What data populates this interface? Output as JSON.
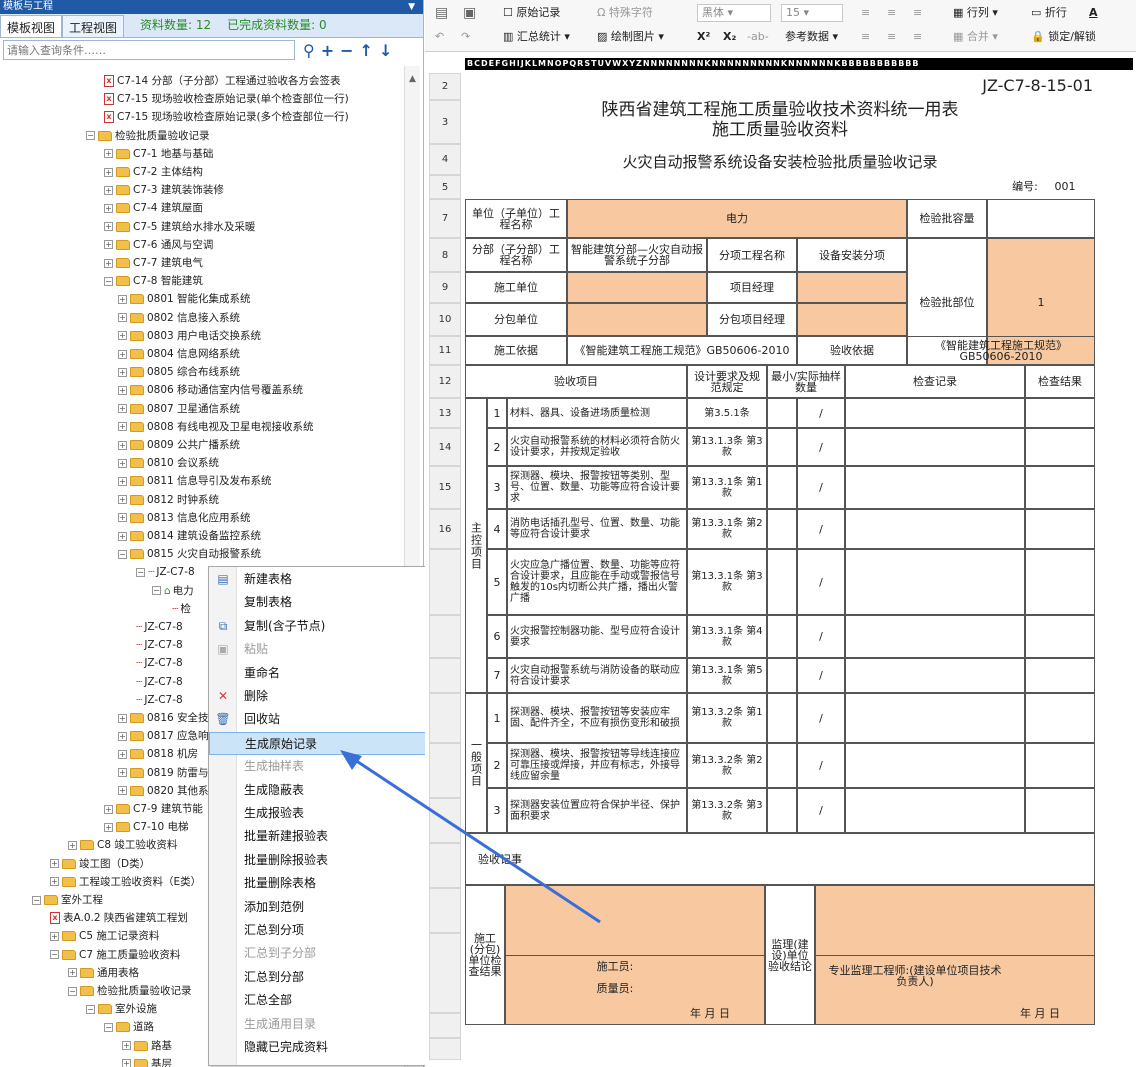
{
  "left_panel": {
    "title": "模板与工程",
    "pin": "▼",
    "tabs": [
      "模板视图",
      "工程视图"
    ],
    "count_label": "资料数量: 12",
    "done_label": "已完成资料数量: 0",
    "search_placeholder": "请输入查询条件……"
  },
  "tree": [
    {
      "text": "C7-14 分部（子分部）工程通过验收各方会签表",
      "icon": "pdf"
    },
    {
      "text": "C7-15 现场验收检查原始记录(单个检查部位一行)",
      "icon": "pdf"
    },
    {
      "text": "C7-15 现场验收检查原始记录(多个检查部位一行)",
      "icon": "pdf"
    },
    {
      "text": "检验批质量验收记录",
      "icon": "folder",
      "exp": "−"
    },
    {
      "text": "C7-1 地基与基础",
      "icon": "folder",
      "exp": "+"
    },
    {
      "text": "C7-2 主体结构",
      "icon": "folder",
      "exp": "+"
    },
    {
      "text": "C7-3 建筑装饰装修",
      "icon": "folder",
      "exp": "+"
    },
    {
      "text": "C7-4 建筑屋面",
      "icon": "folder",
      "exp": "+"
    },
    {
      "text": "C7-5 建筑给水排水及采暖",
      "icon": "folder",
      "exp": "+"
    },
    {
      "text": "C7-6 通风与空调",
      "icon": "folder",
      "exp": "+"
    },
    {
      "text": "C7-7 建筑电气",
      "icon": "folder",
      "exp": "+"
    },
    {
      "text": "C7-8 智能建筑",
      "icon": "folder",
      "exp": "−"
    },
    {
      "text": "0801 智能化集成系统",
      "icon": "folder",
      "exp": "+"
    },
    {
      "text": "0802 信息接入系统",
      "icon": "folder",
      "exp": "+"
    },
    {
      "text": "0803 用户电话交换系统",
      "icon": "folder",
      "exp": "+"
    },
    {
      "text": "0804 信息网络系统",
      "icon": "folder",
      "exp": "+"
    },
    {
      "text": "0805 综合布线系统",
      "icon": "folder",
      "exp": "+"
    },
    {
      "text": "0806 移动通信室内信号覆盖系统",
      "icon": "folder",
      "exp": "+"
    },
    {
      "text": "0807 卫星通信系统",
      "icon": "folder",
      "exp": "+"
    },
    {
      "text": "0808 有线电视及卫星电视接收系统",
      "icon": "folder",
      "exp": "+"
    },
    {
      "text": "0809 公共广播系统",
      "icon": "folder",
      "exp": "+"
    },
    {
      "text": "0810 会议系统",
      "icon": "folder",
      "exp": "+"
    },
    {
      "text": "0811 信息导引及发布系统",
      "icon": "folder",
      "exp": "+"
    },
    {
      "text": "0812 时钟系统",
      "icon": "folder",
      "exp": "+"
    },
    {
      "text": "0813 信息化应用系统",
      "icon": "folder",
      "exp": "+"
    },
    {
      "text": "0814 建筑设备监控系统",
      "icon": "folder",
      "exp": "+"
    },
    {
      "text": "0815 火灾自动报警系统",
      "icon": "folder",
      "exp": "−"
    },
    {
      "text": "JZ-C7-8",
      "icon": "jian",
      "exp": "−"
    },
    {
      "text": "电力",
      "icon": "home",
      "exp": "−"
    },
    {
      "text": "检",
      "icon": "jian"
    },
    {
      "text": "JZ-C7-8",
      "icon": "jian"
    },
    {
      "text": "JZ-C7-8",
      "icon": "jian"
    },
    {
      "text": "JZ-C7-8",
      "icon": "jian"
    },
    {
      "text": "JZ-C7-8",
      "icon": "jian"
    },
    {
      "text": "JZ-C7-8",
      "icon": "jian"
    },
    {
      "text": "0816 安全技",
      "icon": "folder",
      "exp": "+"
    },
    {
      "text": "0817 应急响",
      "icon": "folder",
      "exp": "+"
    },
    {
      "text": "0818 机房",
      "icon": "folder",
      "exp": "+"
    },
    {
      "text": "0819 防雷与",
      "icon": "folder",
      "exp": "+"
    },
    {
      "text": "0820 其他系",
      "icon": "folder",
      "exp": "+"
    },
    {
      "text": "C7-9 建筑节能",
      "icon": "folder",
      "exp": "+"
    },
    {
      "text": "C7-10 电梯",
      "icon": "folder",
      "exp": "+"
    },
    {
      "text": "C8 竣工验收资料",
      "icon": "folder",
      "exp": "+"
    },
    {
      "text": "竣工图（D类）",
      "icon": "folder",
      "exp": "+"
    },
    {
      "text": "工程竣工验收资料（E类）",
      "icon": "folder",
      "exp": "+"
    },
    {
      "text": "室外工程",
      "icon": "folder",
      "exp": "−"
    },
    {
      "text": "表A.0.2 陕西省建筑工程划",
      "icon": "pdf"
    },
    {
      "text": "C5 施工记录资料",
      "icon": "folder",
      "exp": "+"
    },
    {
      "text": "C7 施工质量验收资料",
      "icon": "folder",
      "exp": "−"
    },
    {
      "text": "通用表格",
      "icon": "folder",
      "exp": "+"
    },
    {
      "text": "检验批质量验收记录",
      "icon": "folder",
      "exp": "−"
    },
    {
      "text": "室外设施",
      "icon": "folder",
      "exp": "−"
    },
    {
      "text": "道路",
      "icon": "folder",
      "exp": "−"
    },
    {
      "text": "路基",
      "icon": "folder",
      "exp": "+"
    },
    {
      "text": "基层",
      "icon": "folder",
      "exp": "+"
    }
  ],
  "context_menu": [
    {
      "label": "新建表格",
      "icon": "new-table-icon",
      "glyph": "▤",
      "enabled": true
    },
    {
      "label": "复制表格",
      "icon": "",
      "glyph": "",
      "enabled": true
    },
    {
      "label": "复制(含子节点)",
      "icon": "copy-icon",
      "glyph": "⧉",
      "enabled": true
    },
    {
      "label": "粘贴",
      "icon": "paste-icon",
      "glyph": "▣",
      "enabled": false
    },
    {
      "label": "重命名",
      "icon": "",
      "glyph": "",
      "enabled": true
    },
    {
      "label": "删除",
      "icon": "delete-icon",
      "glyph": "✕",
      "enabled": true
    },
    {
      "label": "回收站",
      "icon": "recycle-bin-icon",
      "glyph": "🗑",
      "enabled": true
    },
    {
      "label": "生成原始记录",
      "icon": "",
      "glyph": "",
      "enabled": true,
      "highlighted": true
    },
    {
      "label": "生成抽样表",
      "icon": "",
      "glyph": "",
      "enabled": false
    },
    {
      "label": "生成隐蔽表",
      "icon": "",
      "glyph": "",
      "enabled": true
    },
    {
      "label": "生成报验表",
      "icon": "",
      "glyph": "",
      "enabled": true
    },
    {
      "label": "批量新建报验表",
      "icon": "",
      "glyph": "",
      "enabled": true
    },
    {
      "label": "批量删除报验表",
      "icon": "",
      "glyph": "",
      "enabled": true
    },
    {
      "label": "批量删除表格",
      "icon": "",
      "glyph": "",
      "enabled": true
    },
    {
      "label": "添加到范例",
      "icon": "",
      "glyph": "",
      "enabled": true
    },
    {
      "label": "汇总到分项",
      "icon": "",
      "glyph": "",
      "enabled": true
    },
    {
      "label": "汇总到子分部",
      "icon": "",
      "glyph": "",
      "enabled": false
    },
    {
      "label": "汇总到分部",
      "icon": "",
      "glyph": "",
      "enabled": true
    },
    {
      "label": "汇总全部",
      "icon": "",
      "glyph": "",
      "enabled": true
    },
    {
      "label": "生成通用目录",
      "icon": "",
      "glyph": "",
      "enabled": false
    },
    {
      "label": "隐藏已完成资料",
      "icon": "",
      "glyph": "",
      "enabled": true
    }
  ],
  "toolbar": {
    "original_record": "原始记录",
    "special_chars": "特殊字符",
    "font": "黑体",
    "size": "15",
    "row_col": "行列",
    "fold": "折行",
    "summary_stats": "汇总统计",
    "draw_image": "绘制图片",
    "ref_data": "参考数据",
    "merge": "合并",
    "lock": "锁定/解锁",
    "superscript": "X²",
    "subscript": "X₂",
    "strike": "-ab-"
  },
  "sheet": {
    "col_header": "BCDEFGHIJKLMNOPQRSTUVWXYZNNNNNNNNKNNNNNNNNNKNNNNNNKBBBBBBBBBBB",
    "rows": [
      "2",
      "3",
      "4",
      "5",
      "7",
      "8",
      "9",
      "10",
      "11",
      "12",
      "13",
      "14",
      "15",
      "16",
      "",
      "",
      "",
      "",
      "",
      "",
      "",
      "",
      "",
      "",
      ""
    ],
    "code": "JZ-C7-8-15-01",
    "title1": "陕西省建筑工程施工质量验收技术资料统一用表",
    "title2": "施工质量验收资料",
    "subtitle": "火灾自动报警系统设备安装检验批质量验收记录",
    "number_label": "编号:",
    "number": "001",
    "unit_label": "单位（子单位）工程名称",
    "unit_value": "电力",
    "capacity_label": "检验批容量",
    "division_label": "分部（子分部）工程名称",
    "division_value": "智能建筑分部—火灾自动报警系统子分部",
    "item_label": "分项工程名称",
    "item_value": "设备安装分项",
    "location_label": "检验批部位",
    "location_value": "1",
    "contractor_label": "施工单位",
    "pm_label": "项目经理",
    "sub_label": "分包单位",
    "sub_pm_label": "分包项目经理",
    "basis_label": "施工依据",
    "basis_value": "《智能建筑工程施工规范》GB50606-2010",
    "accept_basis_label": "验收依据",
    "accept_basis_value": "《智能建筑工程施工规范》GB50606-2010",
    "h_item": "验收项目",
    "h_req": "设计要求及规范规定",
    "h_min": "最小/实际抽样数量",
    "h_check": "检查记录",
    "h_result": "检查结果",
    "main_label": "主控项目",
    "general_label": "一般项目",
    "slash": "/",
    "items": [
      {
        "no": "1",
        "text": "材料、器具、设备进场质量检测",
        "ref": "第3.5.1条"
      },
      {
        "no": "2",
        "text": "火灾自动报警系统的材料必须符合防火设计要求，并按规定验收",
        "ref": "第13.1.3条 第3款"
      },
      {
        "no": "3",
        "text": "探测器、模块、报警按钮等类别、型号、位置、数量、功能等应符合设计要求",
        "ref": "第13.3.1条 第1款"
      },
      {
        "no": "4",
        "text": "消防电话插孔型号、位置、数量、功能等应符合设计要求",
        "ref": "第13.3.1条 第2款"
      },
      {
        "no": "5",
        "text": "火灾应急广播位置、数量、功能等应符合设计要求，且应能在手动或警报信号触发的10s内切断公共广播，播出火警广播",
        "ref": "第13.3.1条 第3款"
      },
      {
        "no": "6",
        "text": "火灾报警控制器功能、型号应符合设计要求",
        "ref": "第13.3.1条 第4款"
      },
      {
        "no": "7",
        "text": "火灾自动报警系统与消防设备的联动应符合设计要求",
        "ref": "第13.3.1条 第5款"
      },
      {
        "no": "1",
        "text": "探测器、模块、报警按钮等安装应牢固、配件齐全，不应有损伤变形和破损",
        "ref": "第13.3.2条 第1款"
      },
      {
        "no": "2",
        "text": "探测器、模块、报警按钮等导线连接应可靠压接或焊接，并应有标志，外接导线应留余量",
        "ref": "第13.3.2条 第2款"
      },
      {
        "no": "3",
        "text": "探测器安装位置应符合保护半径、保护面积要求",
        "ref": "第13.3.2条 第3款"
      }
    ],
    "record_label": "验收记事",
    "construction_label": "施工(分包)单位检查结果",
    "builder_label": "施工员:",
    "quality_label": "质量员:",
    "date_label": "年  月  日",
    "supervisor_label": "监理(建设)单位验收结论",
    "engineer_label": "专业监理工程师:(建设单位项目技术负责人)"
  }
}
